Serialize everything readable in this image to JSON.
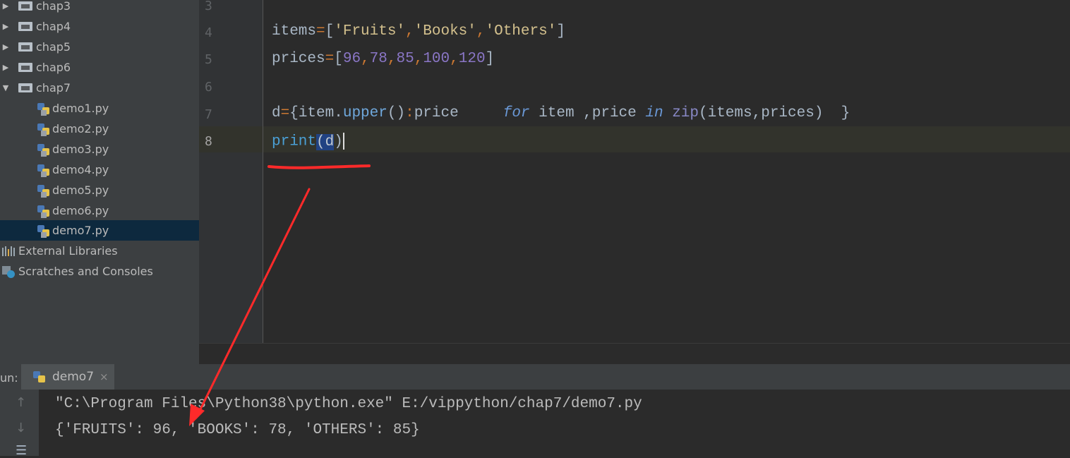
{
  "project_tree": {
    "items": [
      {
        "label": "chap3",
        "kind": "folder",
        "expanded": false
      },
      {
        "label": "chap4",
        "kind": "folder",
        "expanded": false
      },
      {
        "label": "chap5",
        "kind": "folder",
        "expanded": false
      },
      {
        "label": "chap6",
        "kind": "folder",
        "expanded": false
      },
      {
        "label": "chap7",
        "kind": "folder",
        "expanded": true
      },
      {
        "label": "demo1.py",
        "kind": "python-file"
      },
      {
        "label": "demo2.py",
        "kind": "python-file"
      },
      {
        "label": "demo3.py",
        "kind": "python-file"
      },
      {
        "label": "demo4.py",
        "kind": "python-file"
      },
      {
        "label": "demo5.py",
        "kind": "python-file"
      },
      {
        "label": "demo6.py",
        "kind": "python-file"
      },
      {
        "label": "demo7.py",
        "kind": "python-file",
        "selected": true
      },
      {
        "label": "External Libraries",
        "kind": "libraries"
      },
      {
        "label": "Scratches and Consoles",
        "kind": "scratches"
      }
    ]
  },
  "editor": {
    "line_numbers": [
      "3",
      "4",
      "5",
      "6",
      "7",
      "8"
    ],
    "current_line": "8",
    "lines": {
      "line4": {
        "var": "items",
        "eq": "=",
        "open": "[",
        "s1": "'Fruits'",
        "c1": ",",
        "s2": "'Books'",
        "c2": ",",
        "s3": "'Others'",
        "close": "]"
      },
      "line5": {
        "var": "prices",
        "eq": "=",
        "open": "[",
        "n1": "96",
        "c1": ",",
        "n2": "78",
        "c2": ",",
        "n3": "85",
        "c3": ",",
        "n4": "100",
        "c4": ",",
        "n5": "120",
        "close": "]"
      },
      "line7": {
        "p1": "d",
        "eq": "=",
        "p2": "{item.",
        "method": "upper",
        "p3": "()",
        "colon": ":",
        "p4": "price     ",
        "for_kw": "for",
        "p5": " item ,price ",
        "in_kw": "in",
        "p6": " ",
        "zip": "zip",
        "p7": "(items,prices)  }"
      },
      "line8": {
        "print": "print",
        "paren_open": "(",
        "arg": "d",
        "paren_close": ")"
      }
    }
  },
  "run_panel": {
    "label": "un:",
    "tab_title": "demo7",
    "tab_close": "×",
    "tools": {
      "up": "↑",
      "down": "↓",
      "wrap": "☰"
    },
    "console_lines": [
      "\"C:\\Program Files\\Python38\\python.exe\" E:/vippython/chap7/demo7.py",
      "{'FRUITS': 96, 'BOOKS': 78, 'OTHERS': 85}"
    ]
  },
  "colors": {
    "annotation_red": "#ff2a2a",
    "selection": "#214283",
    "tree_selected": "#0d293e"
  }
}
